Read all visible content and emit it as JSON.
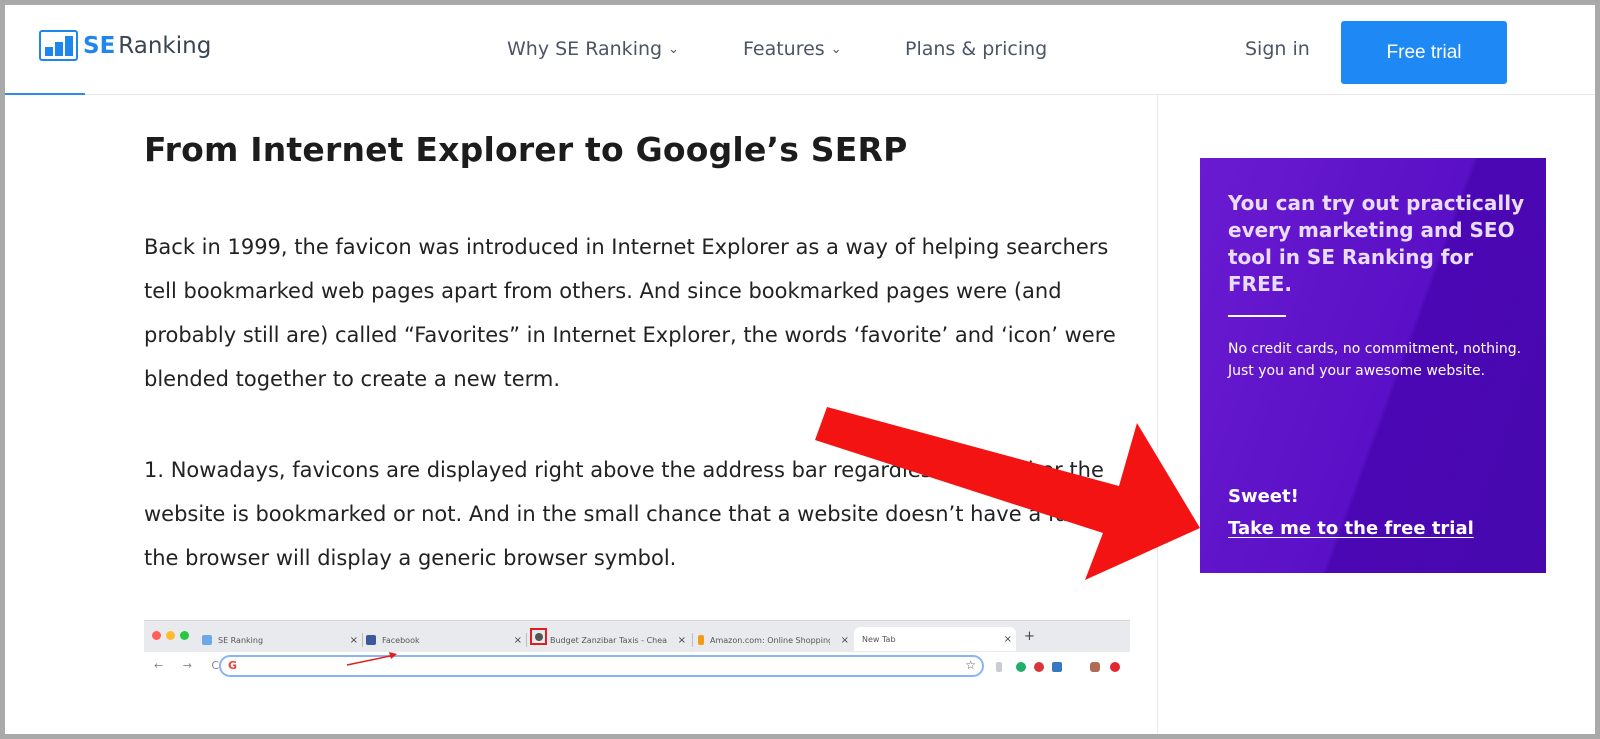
{
  "header": {
    "logo_se": "SE",
    "logo_ranking": "Ranking",
    "nav": {
      "why": "Why SE Ranking",
      "features": "Features",
      "plans": "Plans & pricing"
    },
    "signin": "Sign in",
    "free_trial": "Free trial"
  },
  "article": {
    "title": "From Internet Explorer to Google’s SERP",
    "paragraph1": "Back in 1999, the favicon was introduced in Internet Explorer as a way of helping searchers tell bookmarked web pages apart from others. And since bookmarked pages were (and probably still are) called “Favorites” in Internet Explorer, the words ‘favorite’ and ‘icon’ were blended together to create a new term.",
    "paragraph2": "1. Nowadays, favicons are displayed right above the address bar regardless of whether the website is bookmarked or not. And in the small chance that a website doesn’t have a favicon, the browser will display a generic browser symbol."
  },
  "browser_image": {
    "tabs": [
      {
        "label": "SE Ranking"
      },
      {
        "label": "Facebook"
      },
      {
        "label": "Budget Zanzibar Taxis - Chea"
      },
      {
        "label": "Amazon.com: Online Shopping"
      },
      {
        "label": "New Tab"
      }
    ],
    "new_tab": "+",
    "nav_buttons": "← → C",
    "omnibox_g": "G",
    "close": "×",
    "star": "☆"
  },
  "promo": {
    "headline": "You can try out practically every marketing and SEO tool in SE Ranking for FREE.",
    "line1": "No credit cards, no commitment, nothing.",
    "line2": "Just you and your awesome website.",
    "sweet": "Sweet!",
    "link": "Take me to the free trial"
  },
  "colors": {
    "brand_blue": "#1e88f5",
    "promo_purple": "#5a10c6",
    "arrow_red": "#f21111"
  },
  "icons": {
    "chevron": "chevron-down-icon",
    "arrow": "red-arrow-annotation"
  }
}
